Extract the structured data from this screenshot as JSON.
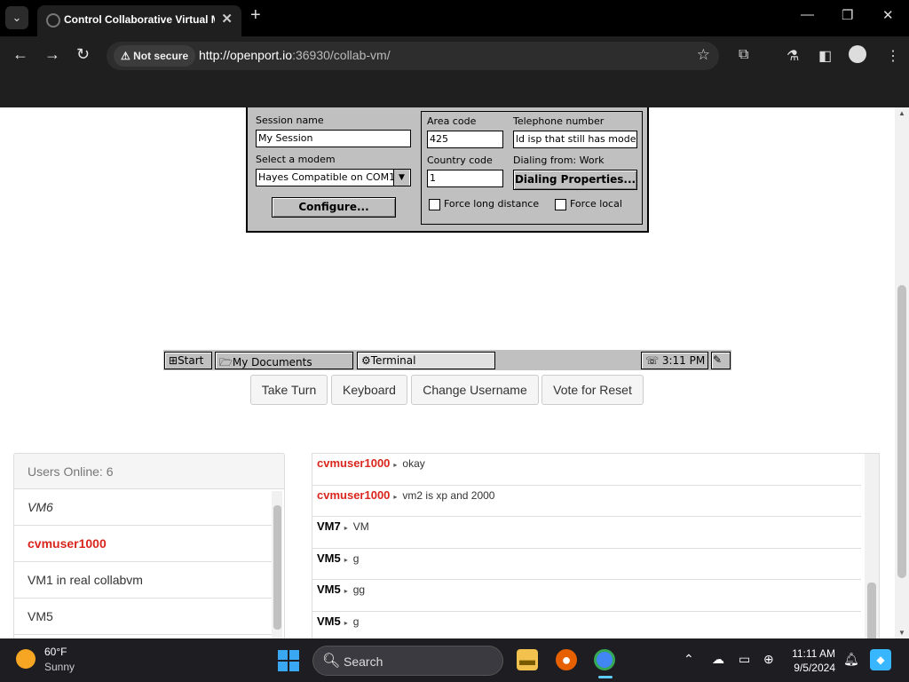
{
  "browser": {
    "tab_title": "Control Collaborative Virtual Machine",
    "security_label": "Not secure",
    "url_host": "http://openport.io",
    "url_rest": ":36930/collab-vm/"
  },
  "dialog": {
    "session_name_label": "Session name",
    "session_name_value": "My Session",
    "modem_label": "Select a modem",
    "modem_value": "Hayes Compatible on COM1",
    "configure_button": "Configure...",
    "area_code_label": "Area code",
    "area_code_value": "425",
    "telephone_label": "Telephone number",
    "telephone_value": "ld isp that still has mode",
    "country_code_label": "Country code",
    "country_code_value": "1",
    "dialing_from": "Dialing from: Work",
    "dialing_properties_button": "Dialing Properties...",
    "force_long_distance": "Force long distance",
    "force_local": "Force local"
  },
  "vm_taskbar": {
    "start": "Start",
    "items": [
      "My Documents",
      "Terminal"
    ],
    "time": "3:11 PM"
  },
  "vm_controls": [
    "Take Turn",
    "Keyboard",
    "Change Username",
    "Vote for Reset"
  ],
  "users": {
    "header": "Users Online: 6",
    "list": [
      {
        "name": "VM6",
        "style": "italic"
      },
      {
        "name": "cvmuser1000",
        "style": "red-bold"
      },
      {
        "name": "VM1 in real collabvm",
        "style": "normal"
      },
      {
        "name": "VM5",
        "style": "normal"
      }
    ]
  },
  "chat": [
    {
      "user": "cvmuser1000",
      "red": true,
      "text": "okay"
    },
    {
      "user": "cvmuser1000",
      "red": true,
      "text": "vm2 is xp and 2000"
    },
    {
      "user": "VM7",
      "red": false,
      "text": "VM"
    },
    {
      "user": "VM5",
      "red": false,
      "text": "g"
    },
    {
      "user": "VM5",
      "red": false,
      "text": "gg"
    },
    {
      "user": "VM5",
      "red": false,
      "text": "g"
    }
  ],
  "taskbar": {
    "weather_temp": "60°F",
    "weather_desc": "Sunny",
    "search_label": "Search",
    "time": "11:11 AM",
    "date": "9/5/2024"
  },
  "colors": {
    "chat_red": "#d9251c",
    "win_accent": "#3aa7f2"
  }
}
